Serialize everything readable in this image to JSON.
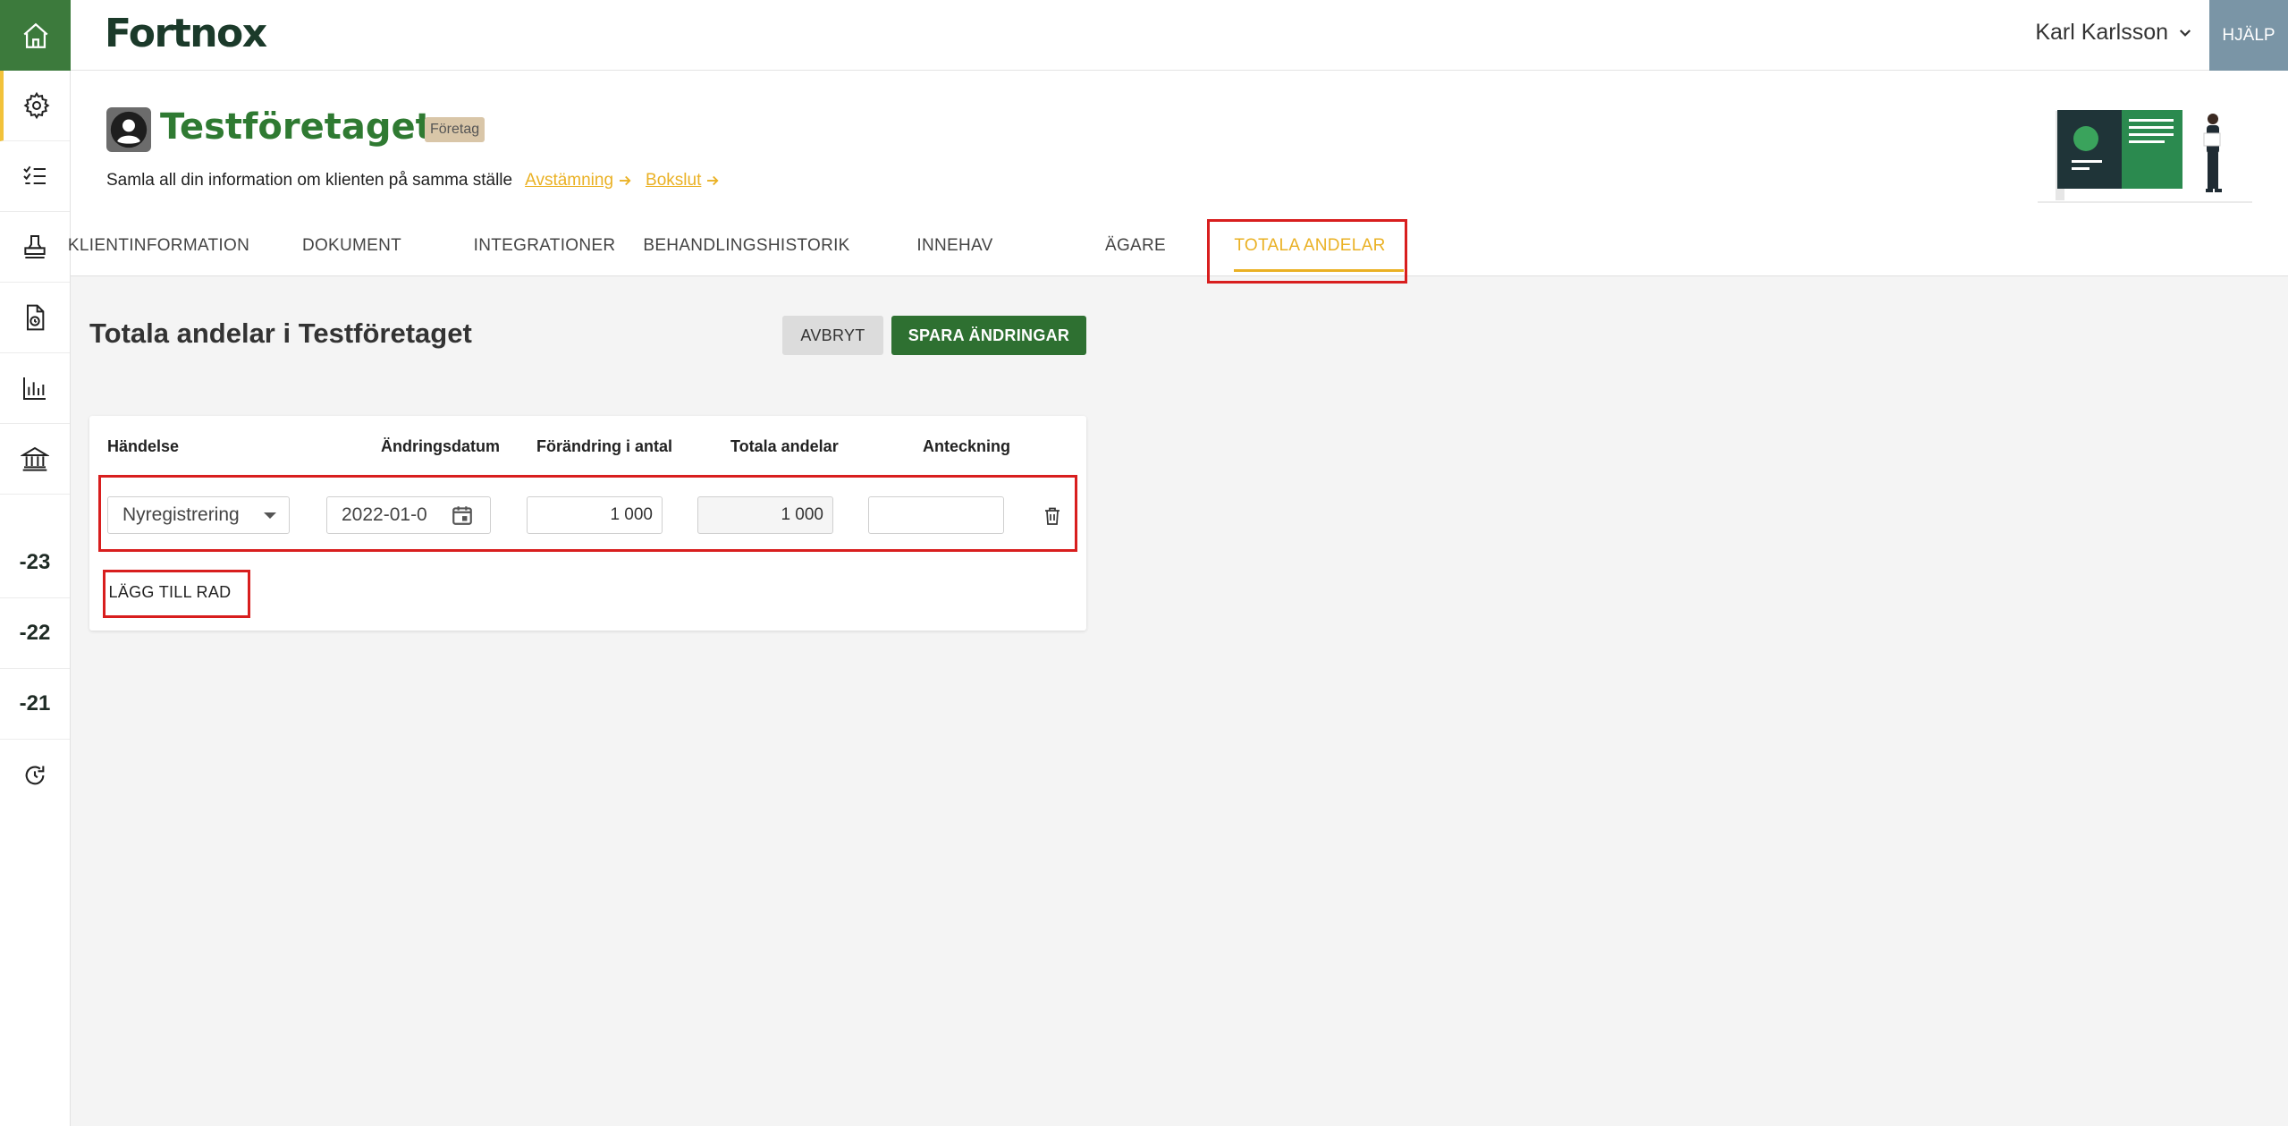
{
  "app": {
    "logo": "Fortnox",
    "user_name": "Karl Karlsson",
    "help_label": "HJÄLP"
  },
  "rail": {
    "years": [
      "-23",
      "-22",
      "-21"
    ]
  },
  "header": {
    "company_name": "Testföretaget",
    "badge": "Företag",
    "subtitle": "Samla all din information om klienten på samma ställe",
    "link_reconciliation": "Avstämning",
    "link_closing": "Bokslut"
  },
  "tabs": [
    {
      "label": "KLIENTINFORMATION"
    },
    {
      "label": "DOKUMENT"
    },
    {
      "label": "INTEGRATIONER"
    },
    {
      "label": "BEHANDLINGSHISTORIK"
    },
    {
      "label": "INNEHAV"
    },
    {
      "label": "ÄGARE"
    },
    {
      "label": "TOTALA ANDELAR",
      "active": true
    }
  ],
  "main": {
    "title": "Totala andelar i Testföretaget",
    "cancel_label": "AVBRYT",
    "save_label": "SPARA ÄNDRINGAR",
    "columns": [
      "Händelse",
      "Ändringsdatum",
      "Förändring i antal",
      "Totala andelar",
      "Anteckning"
    ],
    "row": {
      "event": "Nyregistrering",
      "date": "2022-01-0",
      "change": "1 000",
      "total": "1 000",
      "note": ""
    },
    "add_row_label": "LÄGG TILL RAD"
  },
  "colors": {
    "brand_green": "#2e7031",
    "accent_yellow": "#eab124",
    "highlight_red": "#d81e1e"
  }
}
